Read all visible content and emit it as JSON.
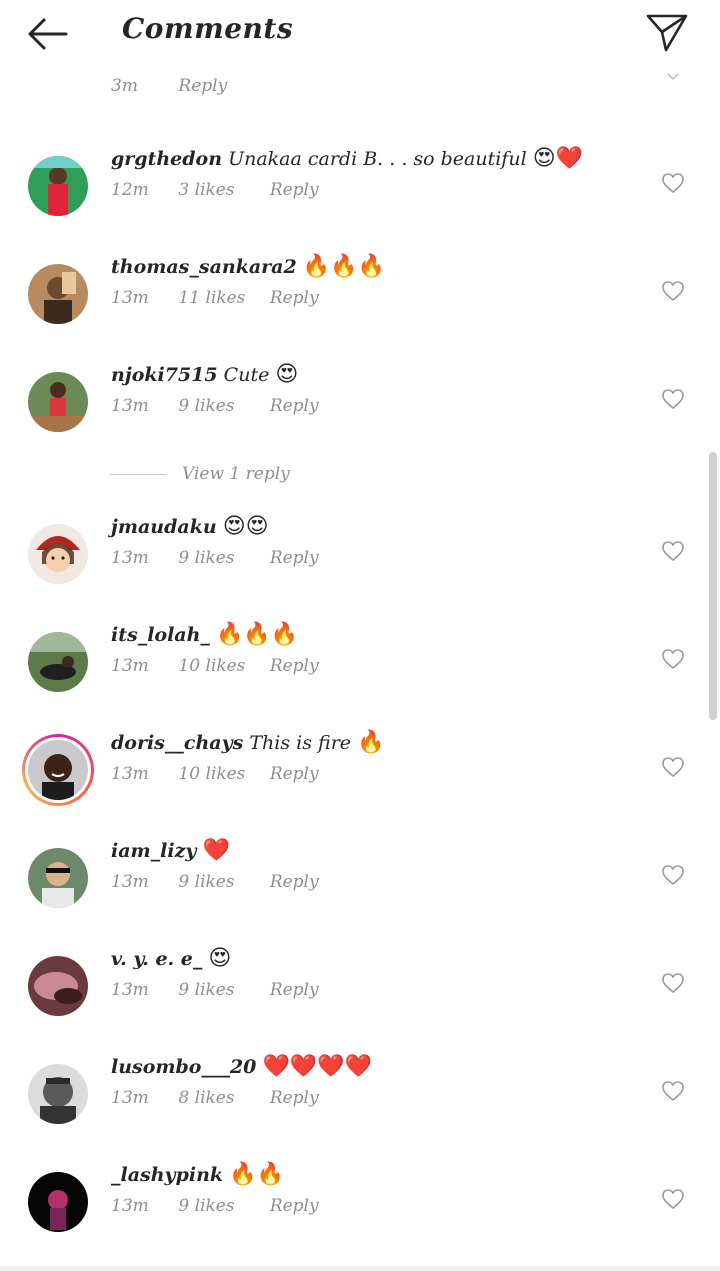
{
  "header": {
    "title": "Comments",
    "back_icon": "arrow-left-icon",
    "send_icon": "paper-plane-icon"
  },
  "top_partial": {
    "time": "3m",
    "reply": "Reply"
  },
  "comments": [
    {
      "username": "grgthedon",
      "text": "Unakaa cardi B. . . so beautiful",
      "emoji": "😍❤️",
      "time": "12m",
      "likes": "3 likes",
      "reply": "Reply"
    },
    {
      "username": "thomas_sankara2",
      "text": "",
      "emoji": "🔥🔥🔥",
      "time": "13m",
      "likes": "11 likes",
      "reply": "Reply"
    },
    {
      "username": "njoki7515",
      "text": "Cute",
      "emoji": "😍",
      "time": "13m",
      "likes": "9 likes",
      "reply": "Reply"
    },
    {
      "username": "jmaudaku",
      "text": "",
      "emoji": "😍😍",
      "time": "13m",
      "likes": "9 likes",
      "reply": "Reply"
    },
    {
      "username": "its_lolah_",
      "text": "",
      "emoji": "🔥🔥🔥",
      "time": "13m",
      "likes": "10 likes",
      "reply": "Reply"
    },
    {
      "username": "doris__chays",
      "text": "This is fire",
      "emoji": "🔥",
      "time": "13m",
      "likes": "10 likes",
      "reply": "Reply"
    },
    {
      "username": "iam_lizy",
      "text": "",
      "emoji": "❤️",
      "time": "13m",
      "likes": "9 likes",
      "reply": "Reply"
    },
    {
      "username": "v. y. e. e_",
      "text": "",
      "emoji": "😍",
      "time": "13m",
      "likes": "9 likes",
      "reply": "Reply"
    },
    {
      "username": "lusombo___20",
      "text": "",
      "emoji": "❤️❤️❤️❤️",
      "time": "13m",
      "likes": "8 likes",
      "reply": "Reply"
    },
    {
      "username": "_lashypink",
      "text": "",
      "emoji": "🔥🔥",
      "time": "13m",
      "likes": "9 likes",
      "reply": "Reply"
    }
  ],
  "view_replies": "View 1 reply",
  "colors": {
    "text": "#262626",
    "muted": "#8e8e8e",
    "story_ring": "#d6249f"
  }
}
